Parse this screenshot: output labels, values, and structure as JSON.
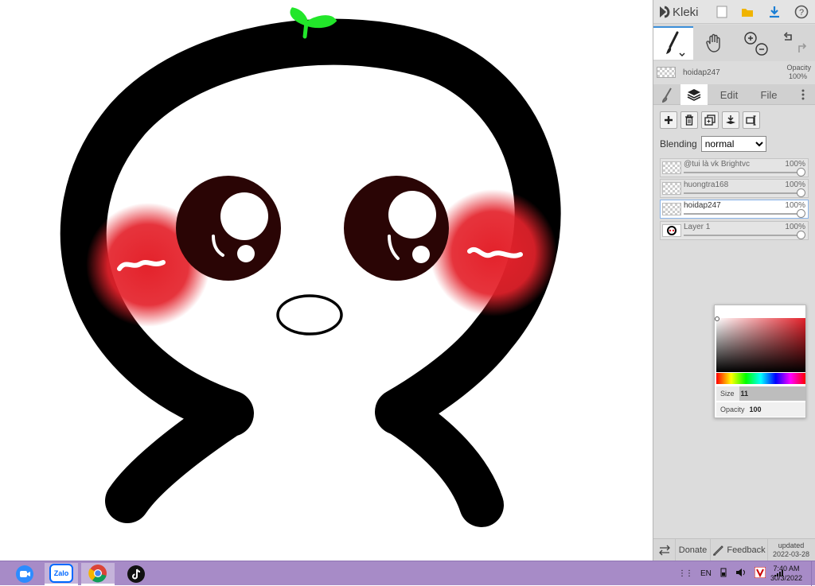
{
  "app": {
    "logo_text": "Kleki"
  },
  "current_layer": {
    "name": "hoidap247",
    "opacity_label": "Opacity",
    "opacity_value": "100%"
  },
  "tabs": {
    "edit": "Edit",
    "file": "File"
  },
  "blending": {
    "label": "Blending",
    "value": "normal"
  },
  "layers": [
    {
      "name": "@tui là vk Brightvc",
      "opacity": "100%"
    },
    {
      "name": "huongtra168",
      "opacity": "100%"
    },
    {
      "name": "hoidap247",
      "opacity": "100%"
    },
    {
      "name": "Layer 1",
      "opacity": "100%"
    }
  ],
  "color_picker": {
    "size_label": "Size",
    "size_value": "11",
    "opacity_label": "Opacity",
    "opacity_value": "100"
  },
  "bottom": {
    "donate": "Donate",
    "feedback": "Feedback",
    "updated_label": "updated",
    "updated_date": "2022-03-28"
  },
  "taskbar": {
    "zalo_label": "Zalo",
    "lang": "EN",
    "time": "7:40 AM",
    "date": "30/3/2022"
  },
  "colors": {
    "accent": "#3b8ed8",
    "taskbar": "#a78bc7",
    "cheek": "#e4222b",
    "sprout": "#22e62a"
  }
}
